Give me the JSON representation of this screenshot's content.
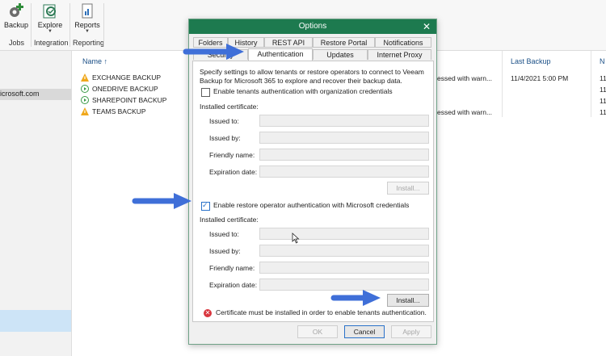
{
  "ribbon": {
    "buttons": [
      {
        "label": "Backup"
      },
      {
        "label": "Explore"
      },
      {
        "label": "Reports"
      }
    ],
    "groups": [
      "Jobs",
      "Integration",
      "Reporting"
    ]
  },
  "nav": {
    "tenant": "icrosoft.com"
  },
  "grid": {
    "columns": {
      "name": "Name ↑",
      "last_backup": "Last Backup",
      "next": "N"
    },
    "rows": [
      {
        "name": "EXCHANGE BACKUP",
        "status_icon": "warning-icon",
        "status": "essed with warn...",
        "last_backup": "11/4/2021 5:00 PM",
        "next": "11"
      },
      {
        "name": "ONEDRIVE BACKUP",
        "status_icon": "play-icon",
        "status": "",
        "last_backup": "",
        "next": "11"
      },
      {
        "name": "SHAREPOINT BACKUP",
        "status_icon": "play-icon",
        "status": "",
        "last_backup": "",
        "next": "11"
      },
      {
        "name": "TEAMS BACKUP",
        "status_icon": "warning-icon",
        "status": "essed with warn...",
        "last_backup": "",
        "next": "11"
      }
    ]
  },
  "dialog": {
    "title": "Options",
    "close": "✕",
    "tabs_row1": [
      "Folders",
      "History",
      "REST API",
      "Restore Portal",
      "Notifications"
    ],
    "tabs_row2": [
      "Security",
      "Authentication",
      "Updates",
      "Internet Proxy"
    ],
    "active_tab": "Authentication",
    "intro": "Specify settings to allow tenants or restore operators to connect to Veeam Backup for Microsoft 365 to explore and recover their backup data.",
    "tenant_auth": {
      "checkbox_label": "Enable tenants authentication with organization credentials",
      "checked": false,
      "section_label": "Installed certificate:",
      "fields": [
        "Issued to:",
        "Issued by:",
        "Friendly name:",
        "Expiration date:"
      ],
      "install_label": "Install..."
    },
    "operator_auth": {
      "checkbox_label": "Enable restore operator authentication with Microsoft credentials",
      "checked": true,
      "section_label": "Installed certificate:",
      "fields": [
        "Issued to:",
        "Issued by:",
        "Friendly name:",
        "Expiration date:"
      ],
      "install_label": "Install..."
    },
    "error_text": "Certificate must be installed in order to enable tenants authentication.",
    "buttons": {
      "ok": "OK",
      "cancel": "Cancel",
      "apply": "Apply"
    }
  },
  "colors": {
    "title_bar": "#1d7a4f",
    "annotation_arrow": "#3f6fd8",
    "error": "#d9363e",
    "selection": "#cde4f7"
  }
}
